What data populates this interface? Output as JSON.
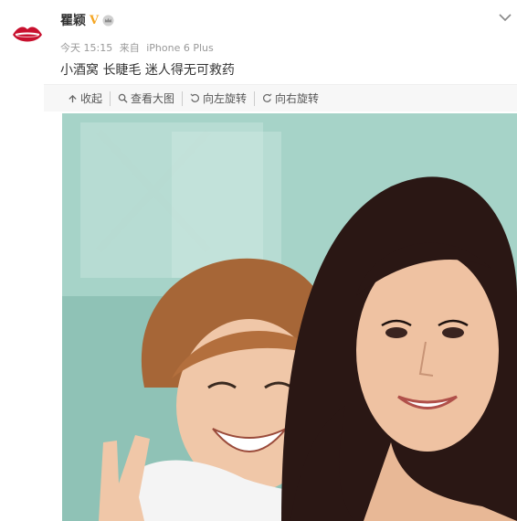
{
  "post": {
    "username": "瞿颖",
    "verified_badge": "V",
    "time": "今天 15:15",
    "source_prefix": "来自",
    "source_device": "iPhone 6 Plus",
    "text": "小酒窝 长睫毛 迷人得无可救药"
  },
  "toolbar": {
    "collapse_label": "收起",
    "view_large_label": "查看大图",
    "rotate_left_label": "向左旋转",
    "rotate_right_label": "向右旋转"
  },
  "icons": {
    "avatar": "lips-logo",
    "badge": "verified-v-badge",
    "member": "crown-icon",
    "menu": "chevron-down-icon",
    "collapse": "arrow-up-icon",
    "view_large": "magnifier-icon",
    "rotate_left": "rotate-left-icon",
    "rotate_right": "rotate-right-icon"
  },
  "colors": {
    "badge": "#f5a623",
    "avatar": "#c8102e",
    "toolbar_bg": "#f7f7f7"
  }
}
